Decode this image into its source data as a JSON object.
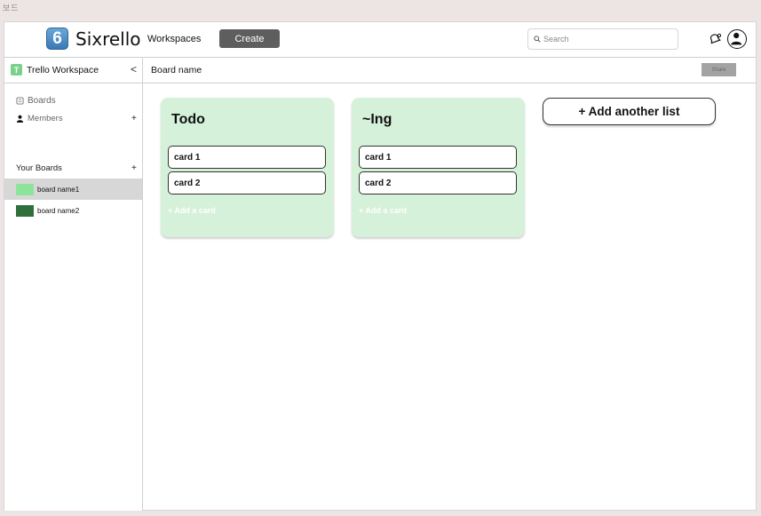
{
  "frame_label": "보드",
  "topbar": {
    "logo_badge": "6",
    "logo_text": "Sixrello",
    "workspaces_label": "Workspaces",
    "create_label": "Create",
    "search_placeholder": "Search",
    "icons": [
      "search-icon",
      "notification-bell-icon",
      "user-avatar-icon"
    ]
  },
  "sidebar": {
    "workspace_badge": "T",
    "workspace_name": "Trello Workspace",
    "collapse_glyph": "<",
    "items": [
      {
        "label": "Boards",
        "icon": "board-icon"
      },
      {
        "label": "Members",
        "icon": "person-icon",
        "action": "+"
      }
    ],
    "your_boards_label": "Your Boards",
    "your_boards_action": "+",
    "boards": [
      {
        "label": "board name1",
        "color": "#8ee39b",
        "active": true
      },
      {
        "label": "board name2",
        "color": "#2e6f3b",
        "active": false
      }
    ]
  },
  "board": {
    "title": "Board name",
    "share_label": "Share",
    "lists": [
      {
        "title": "Todo",
        "cards": [
          "card 1",
          "card 2"
        ],
        "add_card_label": "+ Add a card"
      },
      {
        "title": "~Ing",
        "cards": [
          "card 1",
          "card 2"
        ],
        "add_card_label": "+ Add a card"
      }
    ],
    "add_list_label": "+ Add another list"
  },
  "colors": {
    "list_background": "#d5f1d9",
    "create_button": "#5e5e5e",
    "share_button": "#a3a3a3",
    "active_board_row": "#d7d7d7"
  }
}
